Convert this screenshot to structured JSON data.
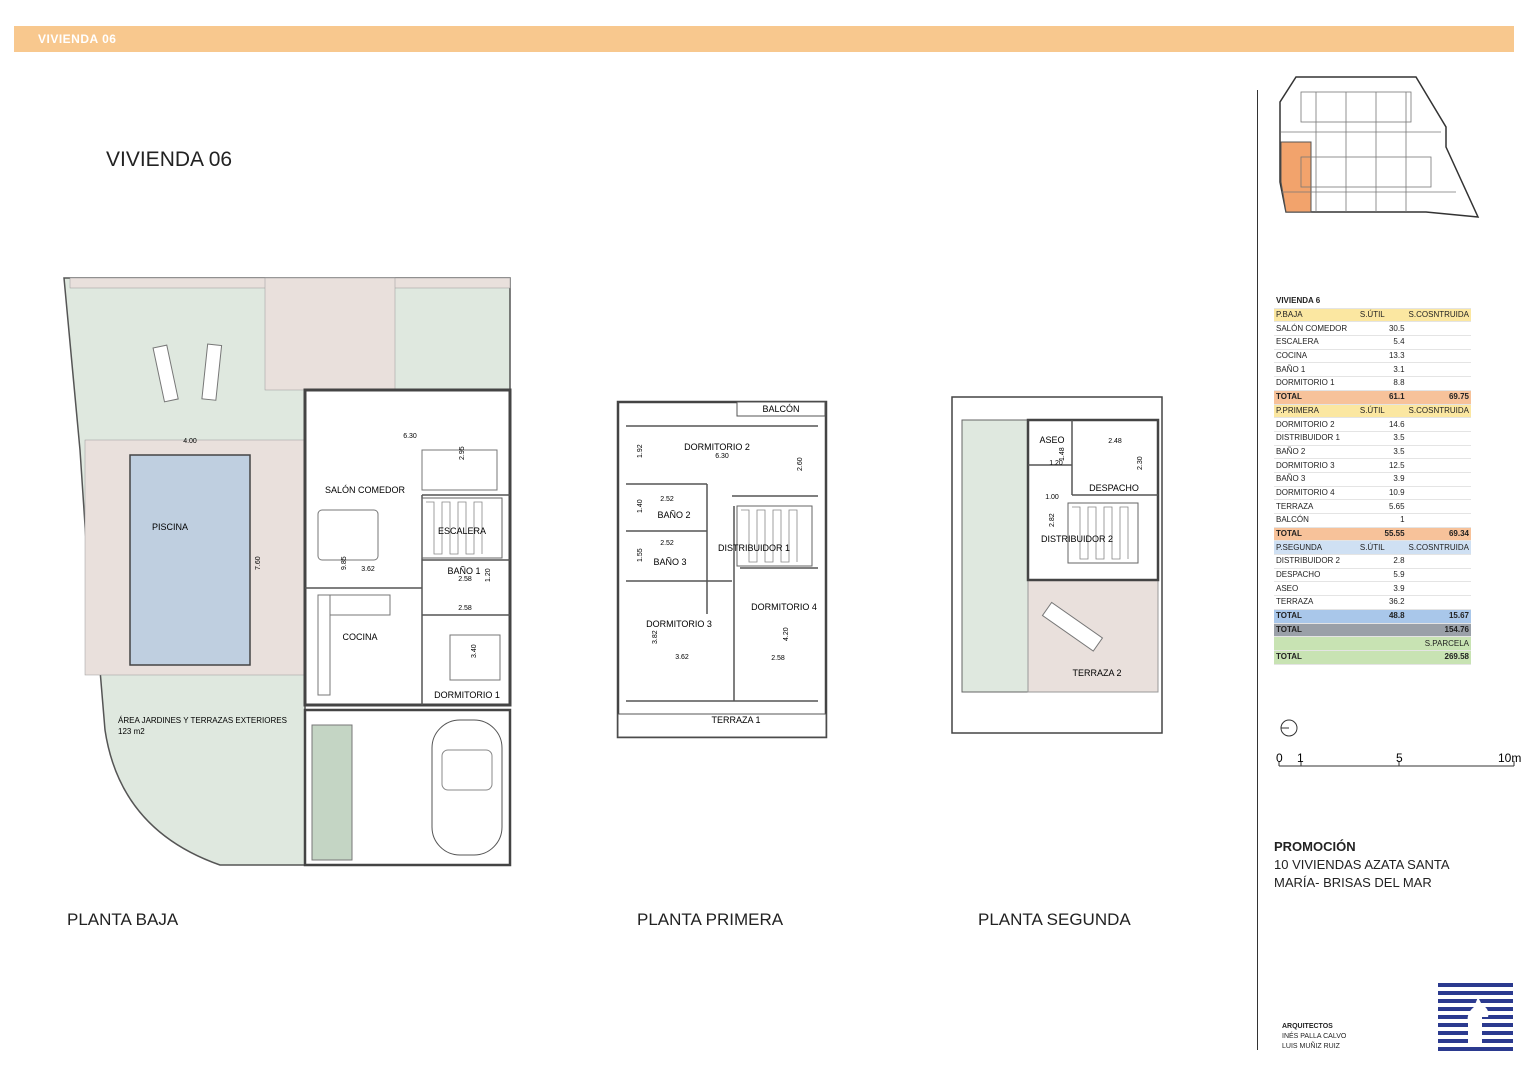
{
  "header": {
    "band_label": "VIVIENDA 06",
    "title": "VIVIENDA 06"
  },
  "colors": {
    "band": "#f8c88e",
    "garden": "#dfe8df",
    "pool": "#bfcfe0",
    "deck": "#e9e0dc",
    "wall": "#555555",
    "highlight": "#f2a36c"
  },
  "ground_floor": {
    "label": "PLANTA BAJA",
    "rooms": {
      "salon": "SALÓN COMEDOR",
      "piscina": "PISCINA",
      "escalera": "ESCALERA",
      "bano1": "BAÑO 1",
      "cocina": "COCINA",
      "dormitorio1": "DORMITORIO 1",
      "jardines": "ÁREA JARDINES Y TERRAZAS EXTERIORES",
      "jardines_area": "123 m2"
    },
    "dims": {
      "pool_w": "4.00",
      "pool_h": "7.60",
      "salon_w": "6.30",
      "salon_h": "2.95",
      "salon_v": "9.85",
      "d362": "3.62",
      "bano_w": "2.58",
      "bano_h": "1.20",
      "dorm_w": "2.58",
      "dorm_h": "3.40"
    }
  },
  "first_floor": {
    "label": "PLANTA PRIMERA",
    "rooms": {
      "balcon": "BALCÓN",
      "dormitorio2": "DORMITORIO 2",
      "bano2": "BAÑO 2",
      "bano3": "BAÑO 3",
      "distribuidor1": "DISTRIBUIDOR 1",
      "dormitorio3": "DORMITORIO 3",
      "dormitorio4": "DORMITORIO 4",
      "terraza1": "TERRAZA 1"
    },
    "dims": {
      "d630": "6.30",
      "d192": "1.92",
      "d260": "2.60",
      "d252a": "2.52",
      "d140": "1.40",
      "d252b": "2.52",
      "d155": "1.55",
      "d382": "3.82",
      "d362": "3.62",
      "d420": "4.20",
      "d258": "2.58"
    }
  },
  "second_floor": {
    "label": "PLANTA SEGUNDA",
    "rooms": {
      "aseo": "ASEO",
      "despacho": "DESPACHO",
      "distribuidor2": "DISTRIBUIDOR 2",
      "terraza2": "TERRAZA 2"
    },
    "dims": {
      "d248": "2.48",
      "d148": "1.48",
      "d120": "1.20",
      "d230": "2.30",
      "d100": "1.00",
      "d282": "2.82"
    }
  },
  "area_table": {
    "title": "VIVIENDA 6",
    "baja": {
      "header": [
        "P.BAJA",
        "S.ÚTIL",
        "S.COSNTRUIDA"
      ],
      "rows": [
        [
          "SALÓN COMEDOR",
          "30.5"
        ],
        [
          "ESCALERA",
          "5.4"
        ],
        [
          "COCINA",
          "13.3"
        ],
        [
          "BAÑO 1",
          "3.1"
        ],
        [
          "DORMITORIO 1",
          "8.8"
        ]
      ],
      "total": [
        "TOTAL",
        "61.1",
        "69.75"
      ]
    },
    "primera": {
      "header": [
        "P.PRIMERA",
        "S.ÚTIL",
        "S.COSNTRUIDA"
      ],
      "rows": [
        [
          "DORMITORIO 2",
          "14.6"
        ],
        [
          "DISTRIBUIDOR 1",
          "3.5"
        ],
        [
          "BAÑO 2",
          "3.5"
        ],
        [
          "DORMITORIO 3",
          "12.5"
        ],
        [
          "BAÑO 3",
          "3.9"
        ],
        [
          "DORMITORIO 4",
          "10.9"
        ],
        [
          "TERRAZA",
          "5.65"
        ],
        [
          "BALCÓN",
          "1"
        ]
      ],
      "total": [
        "TOTAL",
        "55.55",
        "69.34"
      ]
    },
    "segunda": {
      "header": [
        "P.SEGUNDA",
        "S.ÚTIL",
        "S.COSNTRUIDA"
      ],
      "rows": [
        [
          "DISTRIBUIDOR 2",
          "2.8"
        ],
        [
          "DESPACHO",
          "5.9"
        ],
        [
          "ASEO",
          "3.9"
        ],
        [
          "TERRAZA",
          "36.2"
        ]
      ],
      "total": [
        "TOTAL",
        "48.8",
        "15.67"
      ]
    },
    "grand_total": [
      "TOTAL",
      "154.76"
    ],
    "parcela_header": "S.PARCELA",
    "parcela_total": [
      "TOTAL",
      "269.58"
    ]
  },
  "scale": {
    "t0": "0",
    "t1": "1",
    "t5": "5",
    "t10": "10m"
  },
  "promotion": {
    "heading": "PROMOCIÓN",
    "line1": "10 VIVIENDAS AZATA SANTA",
    "line2": "MARÍA- BRISAS DEL MAR"
  },
  "architects": {
    "heading": "ARQUITECTOS",
    "name1": "INÉS PALLA CALVO",
    "name2": "LUIS MUÑIZ RUIZ"
  }
}
